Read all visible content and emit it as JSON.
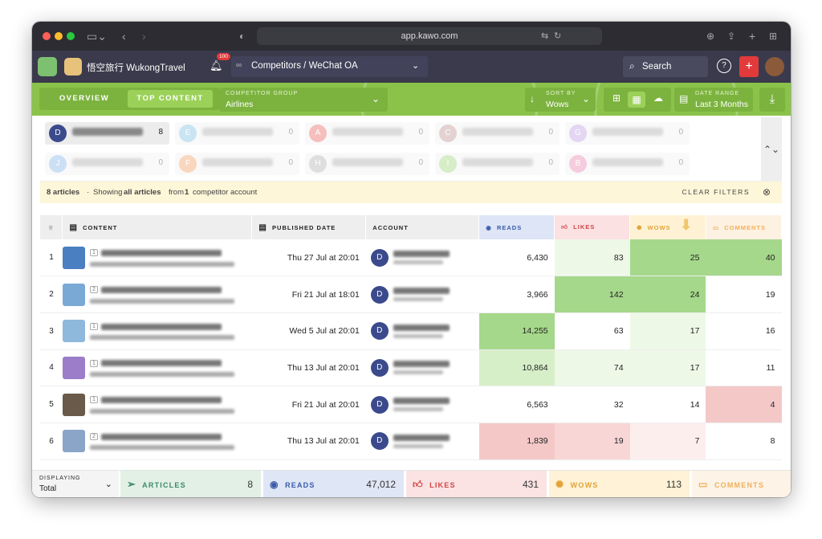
{
  "browser": {
    "url": "app.kawo.com"
  },
  "appbar": {
    "workspace": "悟空旅行 WukongTravel",
    "notif_count": "100",
    "section": "Competitors / WeChat OA",
    "search": "Search"
  },
  "toolbar": {
    "tab_overview": "OVERVIEW",
    "tab_top": "TOP CONTENT",
    "group_key": "COMPETITOR GROUP",
    "group_val": "Airlines",
    "sort_key": "SORT BY",
    "sort_val": "Wows",
    "range_key": "DATE RANGE",
    "range_val": "Last 3 Months"
  },
  "accounts": [
    {
      "initial": "D",
      "count": "8",
      "color": "#3b4a8c"
    },
    {
      "initial": "E",
      "count": "0",
      "color": "#b8dcef"
    },
    {
      "initial": "A",
      "count": "0",
      "color": "#f2aaa8"
    },
    {
      "initial": "C",
      "count": "0",
      "color": "#dcc3c3"
    },
    {
      "initial": "G",
      "count": "0",
      "color": "#dcc8ef"
    },
    {
      "initial": "J",
      "count": "0",
      "color": "#bcd6f2"
    },
    {
      "initial": "F",
      "count": "0",
      "color": "#f7c9a8"
    },
    {
      "initial": "H",
      "count": "0",
      "color": "#d4d4d4"
    },
    {
      "initial": "I",
      "count": "0",
      "color": "#c9e7b6"
    },
    {
      "initial": "B",
      "count": "0",
      "color": "#f2bbd2"
    }
  ],
  "notice": {
    "count": "8 articles",
    "dot": "·",
    "pre": "Showing",
    "bold": "all articles",
    "mid": "from",
    "n": "1",
    "post": "competitor account",
    "clear": "CLEAR FILTERS"
  },
  "table": {
    "headers": {
      "content": "CONTENT",
      "date": "PUBLISHED DATE",
      "account": "ACCOUNT",
      "reads": "READS",
      "likes": "LIKES",
      "wows": "WOWS",
      "comments": "COMMENTS"
    },
    "rows": [
      {
        "rank": "1",
        "pos": "1",
        "date": "Thu 27 Jul at 20:01",
        "acc": "D",
        "reads": "6,430",
        "likes": "83",
        "wows": "25",
        "comments": "40",
        "thumb": "#4a7fc1"
      },
      {
        "rank": "2",
        "pos": "2",
        "date": "Fri 21 Jul at 18:01",
        "acc": "D",
        "reads": "3,966",
        "likes": "142",
        "wows": "24",
        "comments": "19",
        "thumb": "#7aa9d6"
      },
      {
        "rank": "3",
        "pos": "1",
        "date": "Wed 5 Jul at 20:01",
        "acc": "D",
        "reads": "14,255",
        "likes": "63",
        "wows": "17",
        "comments": "16",
        "thumb": "#8fb8dd"
      },
      {
        "rank": "4",
        "pos": "1",
        "date": "Thu 13 Jul at 20:01",
        "acc": "D",
        "reads": "10,864",
        "likes": "74",
        "wows": "17",
        "comments": "11",
        "thumb": "#9b7dc9"
      },
      {
        "rank": "5",
        "pos": "1",
        "date": "Fri 21 Jul at 20:01",
        "acc": "D",
        "reads": "6,563",
        "likes": "32",
        "wows": "14",
        "comments": "4",
        "thumb": "#6a5a4a"
      },
      {
        "rank": "6",
        "pos": "2",
        "date": "Thu 13 Jul at 20:01",
        "acc": "D",
        "reads": "1,839",
        "likes": "19",
        "wows": "7",
        "comments": "8",
        "thumb": "#8aa5c8"
      }
    ]
  },
  "footer": {
    "displaying_key": "DISPLAYING",
    "displaying_val": "Total",
    "articles": "ARTICLES",
    "articles_n": "8",
    "reads": "READS",
    "reads_n": "47,012",
    "likes": "LIKES",
    "likes_n": "431",
    "wows": "WOWS",
    "wows_n": "113",
    "comments": "COMMENTS"
  }
}
